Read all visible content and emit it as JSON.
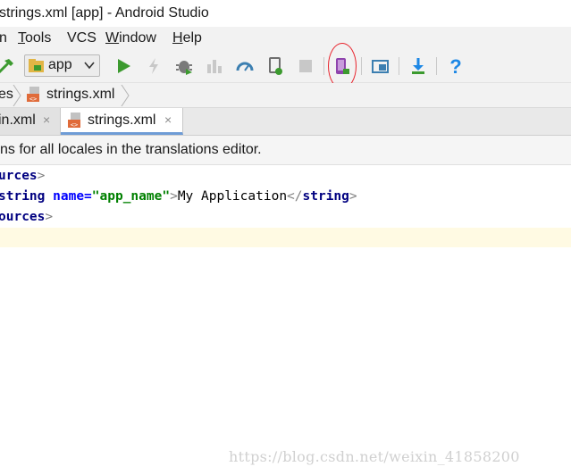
{
  "window": {
    "title": "strings.xml [app] - Android Studio"
  },
  "menubar": {
    "items": [
      {
        "label": "n"
      },
      {
        "mnemonic": "T",
        "rest": "ools"
      },
      {
        "label": "VCS"
      },
      {
        "mnemonic": "W",
        "rest": "indow"
      },
      {
        "mnemonic": "H",
        "rest": "elp"
      }
    ]
  },
  "toolbar": {
    "run_config": "app",
    "icons": [
      "hammer-icon",
      "app-module-icon",
      "chevron-down-icon",
      "run-icon",
      "apply-changes-icon",
      "debug-icon",
      "run-coverage-icon",
      "profiler-icon",
      "attach-debugger-icon",
      "stop-icon",
      "avd-manager-icon",
      "project-structure-icon",
      "sdk-manager-icon",
      "help-icon"
    ],
    "colors": {
      "run": "#3c9a2f",
      "help": "#1e88e5",
      "ring": "#e8232c"
    }
  },
  "navbar": {
    "crumbs": [
      "es",
      "strings.xml"
    ]
  },
  "tabs": [
    {
      "label": "in.xml",
      "close": "×"
    },
    {
      "label": "strings.xml",
      "close": "×"
    }
  ],
  "notice": {
    "text": "ns for all locales in the translations editor."
  },
  "editor": {
    "line1": {
      "tag": "urces",
      "close": ">"
    },
    "line2": {
      "tag": "string",
      "attr": "name=",
      "value": "\"app_name\"",
      "gt": ">",
      "text": "My Application",
      "close_open": "</",
      "close_tag": "string",
      "close_gt": ">"
    },
    "line3": {
      "tag": "ources",
      "close": ">"
    }
  },
  "watermark": "https://blog.csdn.net/weixin_41858200"
}
